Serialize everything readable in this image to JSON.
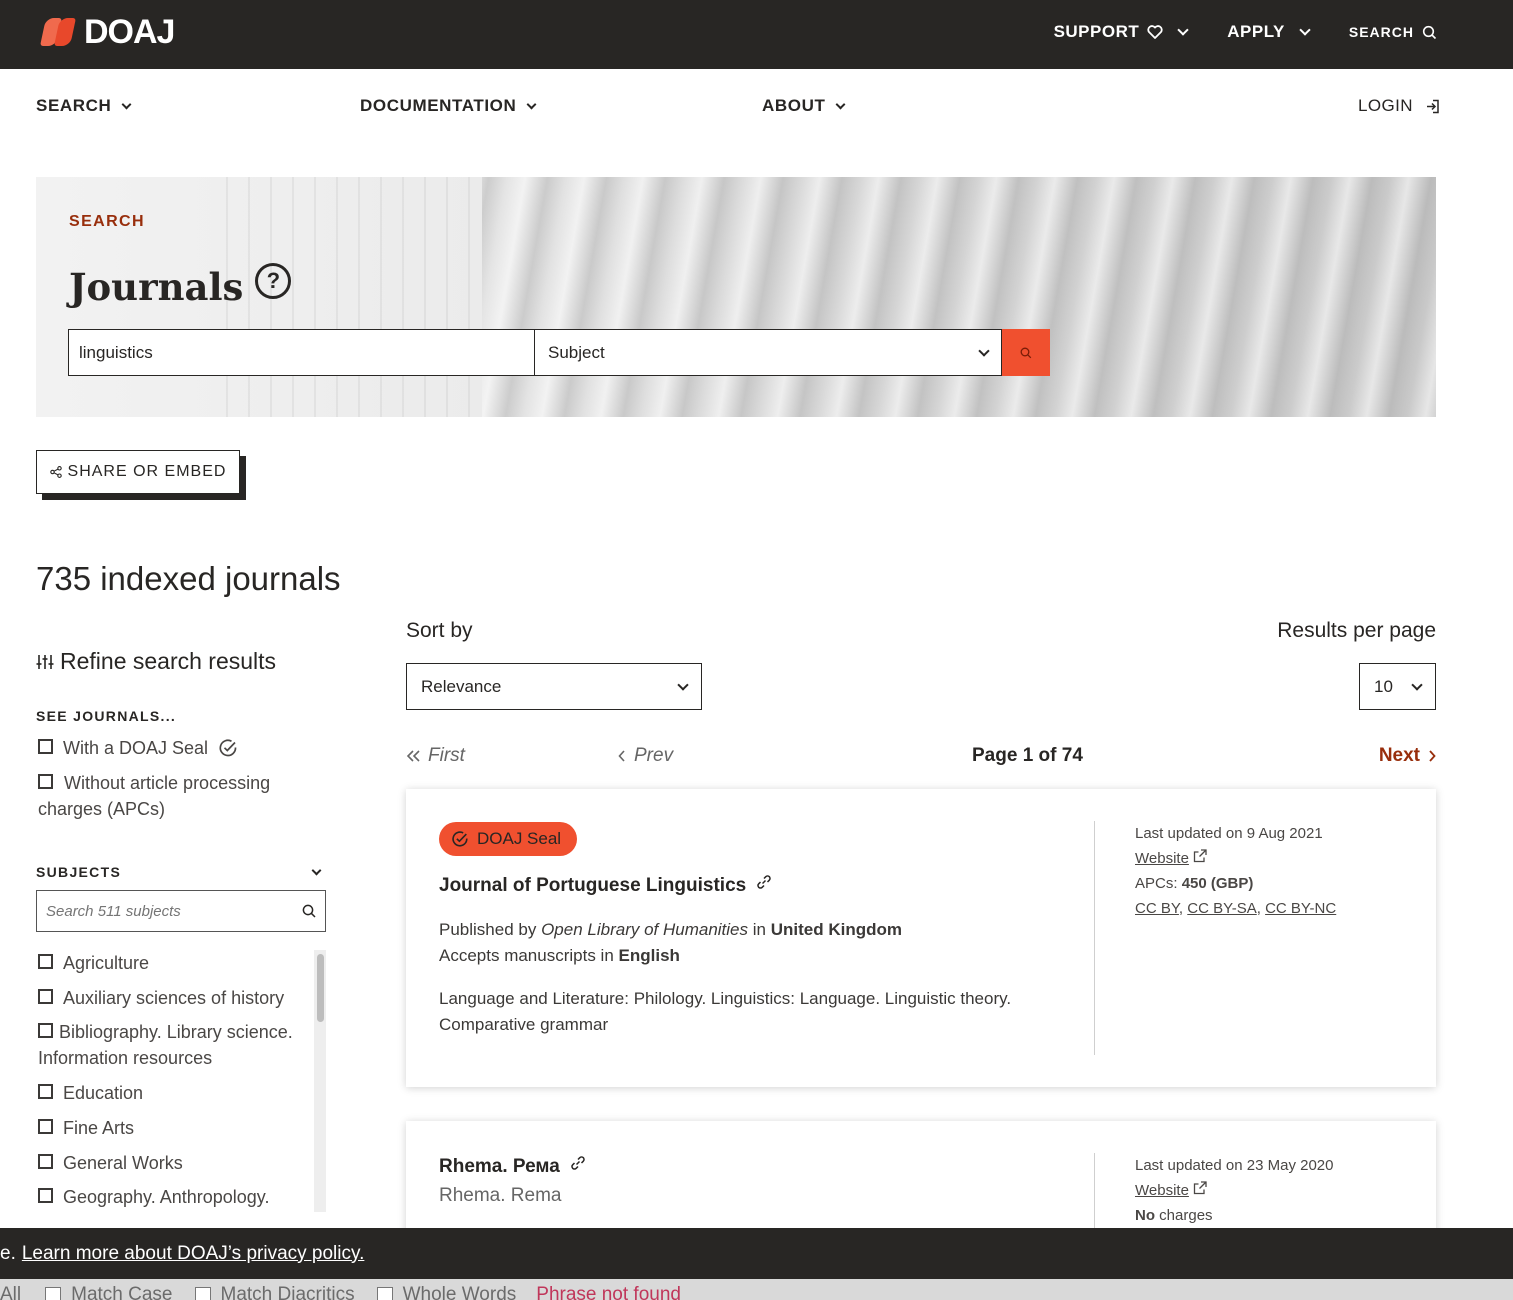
{
  "topbar": {
    "logo_text": "DOAJ",
    "support": "SUPPORT",
    "apply": "APPLY",
    "search": "SEARCH"
  },
  "subnav": {
    "search": "SEARCH",
    "documentation": "DOCUMENTATION",
    "about": "ABOUT",
    "login": "LOGIN"
  },
  "hero": {
    "label": "SEARCH",
    "title": "Journals",
    "help_glyph": "?",
    "query_value": "linguistics",
    "field_selected": "Subject"
  },
  "share": {
    "label": "SHARE OR EMBED"
  },
  "results": {
    "count_text": "735 indexed journals"
  },
  "sidebar": {
    "refine_title": "Refine search results",
    "see_journals_heading": "SEE JOURNALS...",
    "see_journals": [
      {
        "label": "With a DOAJ Seal"
      },
      {
        "label": "Without article processing charges (APCs)"
      }
    ],
    "subjects_heading": "SUBJECTS",
    "subjects_placeholder": "Search 511 subjects",
    "subjects": [
      "Agriculture",
      "Auxiliary sciences of history",
      "Bibliography. Library science. Information resources",
      "Education",
      "Fine Arts",
      "General Works",
      "Geography. Anthropology."
    ]
  },
  "controls": {
    "sort_label": "Sort by",
    "sort_value": "Relevance",
    "rpp_label": "Results per page",
    "rpp_value": "10"
  },
  "pager": {
    "first": "First",
    "prev": "Prev",
    "page": "Page 1 of 74",
    "next": "Next"
  },
  "cards": [
    {
      "seal": "DOAJ Seal",
      "title": "Journal of Portuguese Linguistics",
      "published_prefix": "Published by",
      "publisher": "Open Library of Humanities",
      "in": "in",
      "country": "United Kingdom",
      "accepts_prefix": "Accepts manuscripts in",
      "language": "English",
      "subjects_line1": "Language and Literature: Philology. Linguistics: Language. Linguistic theory.",
      "subjects_line2": "Comparative grammar",
      "updated": "Last updated on 9 Aug 2021",
      "website": "Website",
      "apc_prefix": "APCs:",
      "apc_value": "450 (GBP)",
      "license_1": "CC BY",
      "license_2": "CC BY-SA",
      "license_3": "CC BY-NC"
    },
    {
      "title": "Rhema. Рема",
      "alt_title": "Rhema. Rema",
      "updated": "Last updated on 23 May 2020",
      "website": "Website",
      "charges_bold": "No",
      "charges_rest": "charges"
    }
  ],
  "cookie": {
    "lead": "e.",
    "link": "Learn more about DOAJ’s privacy policy."
  },
  "findbar": {
    "all": "All",
    "match_case": "Match Case",
    "match_diacritics": "Match Diacritics",
    "whole_words": "Whole Words",
    "status": "Phrase not found"
  },
  "colors": {
    "accent": "#f0502f",
    "dark": "#282624",
    "link_red": "#982e0c"
  }
}
